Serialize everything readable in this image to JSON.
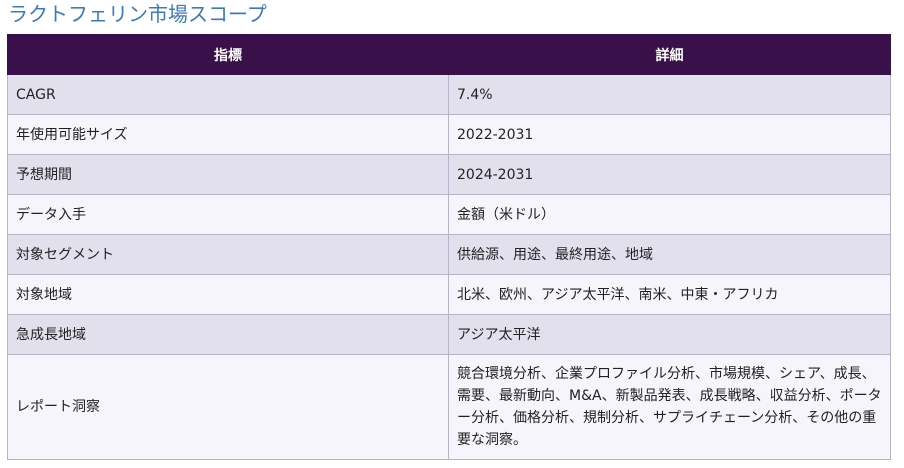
{
  "title": "ラクトフェリン市場スコープ",
  "table": {
    "headers": [
      "指標",
      "詳細"
    ],
    "rows": [
      [
        "CAGR",
        "7.4%"
      ],
      [
        "年使用可能サイズ",
        "2022-2031"
      ],
      [
        "予想期間",
        "2024-2031"
      ],
      [
        "データ入手",
        "金額（米ドル）"
      ],
      [
        "対象セグメント",
        "供給源、用途、最終用途、地域"
      ],
      [
        "対象地域",
        "北米、欧州、アジア太平洋、南米、中東・アフリカ"
      ],
      [
        "急成長地域",
        "アジア太平洋"
      ],
      [
        "レポート洞察",
        "競合環境分析、企業プロファイル分析、市場規模、シェア、成長、需要、最新動向、M&A、新製品発表、成長戦略、収益分析、ポーター分析、価格分析、規制分析、サプライチェーン分析、その他の重要な洞察。"
      ]
    ]
  }
}
